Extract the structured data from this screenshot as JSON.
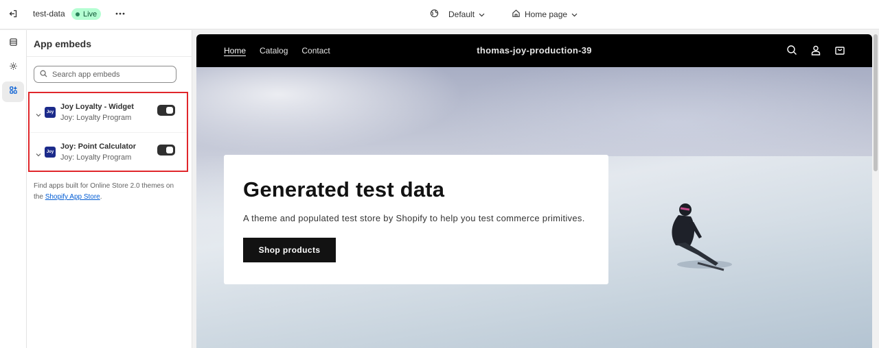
{
  "topbar": {
    "store_name": "test-data",
    "status": "Live",
    "theme_label": "Default",
    "page_label": "Home page"
  },
  "panel": {
    "title": "App embeds",
    "search_placeholder": "Search app embeds",
    "embeds": [
      {
        "name": "Joy Loyalty - Widget",
        "app": "Joy: Loyalty Program",
        "icon_text": "Joy",
        "enabled": true
      },
      {
        "name": "Joy: Point Calculator",
        "app": "Joy: Loyalty Program",
        "icon_text": "Joy",
        "enabled": true
      }
    ],
    "footer_text": "Find apps built for Online Store 2.0 themes on the ",
    "footer_link": "Shopify App Store",
    "footer_end": "."
  },
  "store": {
    "nav_links": [
      "Home",
      "Catalog",
      "Contact"
    ],
    "brand": "thomas-joy-production-39",
    "hero_title": "Generated test data",
    "hero_text": "A theme and populated test store by Shopify to help you test commerce primitives.",
    "hero_button": "Shop products"
  },
  "colors": {
    "highlight": "#e0262a",
    "live_bg": "#b4fed2",
    "live_dot": "#29845a",
    "app_icon": "#1b2a8a"
  }
}
